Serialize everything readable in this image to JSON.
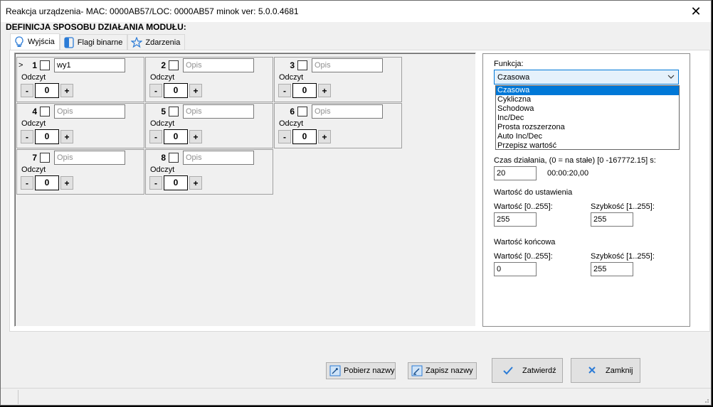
{
  "window": {
    "title": "Reakcja urządzenia- MAC: 0000AB57/LOC: 0000AB57 minok ver: 5.0.0.4681",
    "close_glyph": "✕"
  },
  "heading": "DEFINICJA SPOSOBU DZIAŁANIA MODUŁU:",
  "tabs": [
    {
      "label": "Wyjścia",
      "icon": "lightbulb-icon",
      "active": true
    },
    {
      "label": "Flagi binarne",
      "icon": "flag-icon",
      "active": false
    },
    {
      "label": "Zdarzenia",
      "icon": "star-icon",
      "active": false
    }
  ],
  "outputs": {
    "odczyt_label": "Odczyt",
    "minus_label": "-",
    "plus_label": "+",
    "desc_placeholder": "Opis",
    "selected_marker": ">",
    "items": [
      {
        "num": "1",
        "desc": "wy1",
        "value": "0"
      },
      {
        "num": "2",
        "desc": "",
        "value": "0"
      },
      {
        "num": "3",
        "desc": "",
        "value": "0"
      },
      {
        "num": "4",
        "desc": "",
        "value": "0"
      },
      {
        "num": "5",
        "desc": "",
        "value": "0"
      },
      {
        "num": "6",
        "desc": "",
        "value": "0"
      },
      {
        "num": "7",
        "desc": "",
        "value": "0"
      },
      {
        "num": "8",
        "desc": "",
        "value": "0"
      }
    ]
  },
  "config": {
    "funkcja_label": "Funkcja:",
    "funkcja_selected": "Czasowa",
    "funkcja_options": [
      "Czasowa",
      "Cykliczna",
      "Schodowa",
      "Inc/Dec",
      "Prosta rozszerzona",
      "Auto Inc/Dec",
      "Przepisz wartość"
    ],
    "czas_label": "Czas działania, (0 = na stałe) [0 -167772.15] s:",
    "czas_value": "20",
    "czas_display": "00:00:20,00",
    "ustawienie_heading": "Wartość do ustawienia",
    "ustawienie_wartosc_label": "Wartość [0..255]:",
    "ustawienie_wartosc_value": "255",
    "ustawienie_szybkosc_label": "Szybkość [1..255]:",
    "ustawienie_szybkosc_value": "255",
    "koncowa_heading": "Wartość końcowa",
    "koncowa_wartosc_label": "Wartość [0..255]:",
    "koncowa_wartosc_value": "0",
    "koncowa_szybkosc_label": "Szybkość [1..255]:",
    "koncowa_szybkosc_value": "255"
  },
  "buttons": {
    "pobierz": "Pobierz nazwy",
    "zapisz": "Zapisz nazwy",
    "zatwierdz": "Zatwierdź",
    "zamknij": "Zamknij"
  },
  "colors": {
    "accent": "#0078d7",
    "confirm_check": "#2b7bd6",
    "cancel_x": "#2b7bd6"
  }
}
